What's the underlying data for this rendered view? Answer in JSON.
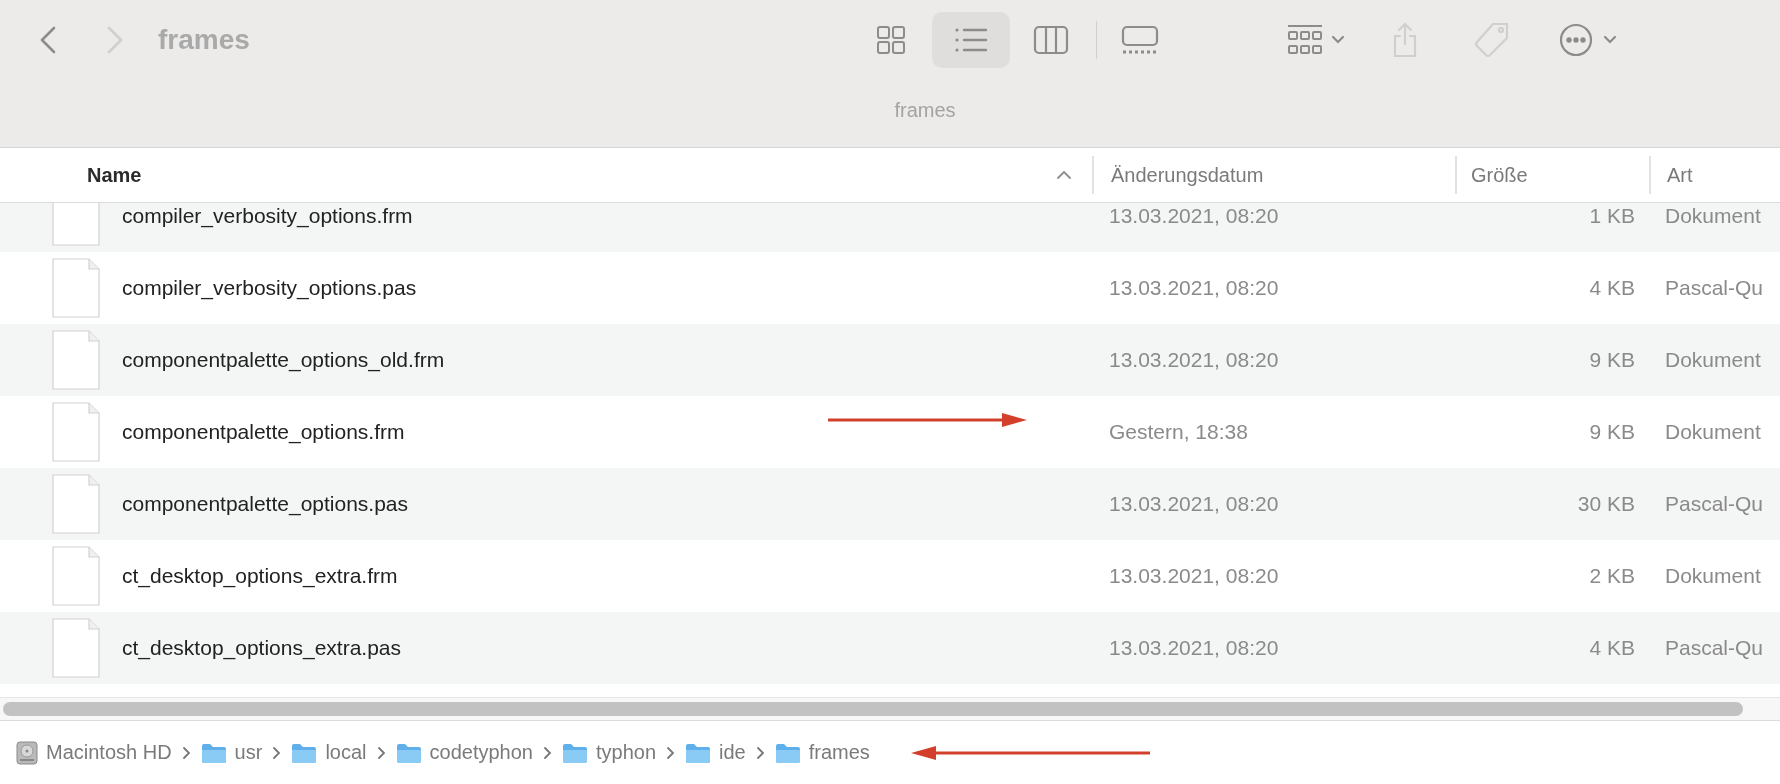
{
  "toolbar": {
    "title": "frames",
    "subtitle": "frames",
    "view_modes": [
      {
        "kind": "icons",
        "selected": false
      },
      {
        "kind": "list",
        "selected": true
      },
      {
        "kind": "columns",
        "selected": false
      },
      {
        "kind": "gallery",
        "selected": false
      }
    ]
  },
  "table": {
    "columns": [
      {
        "label": "Name",
        "sorted": true
      },
      {
        "label": "Änderungsdatum",
        "sorted": false
      },
      {
        "label": "Größe",
        "sorted": false
      },
      {
        "label": "Art",
        "sorted": false
      }
    ],
    "rows": [
      {
        "name": "compiler_verbosity_options.frm",
        "date": "13.03.2021, 08:20",
        "size": "1 KB",
        "kind": "Dokument"
      },
      {
        "name": "compiler_verbosity_options.pas",
        "date": "13.03.2021, 08:20",
        "size": "4 KB",
        "kind": "Pascal-Qu"
      },
      {
        "name": "componentpalette_options_old.frm",
        "date": "13.03.2021, 08:20",
        "size": "9 KB",
        "kind": "Dokument"
      },
      {
        "name": "componentpalette_options.frm",
        "date": "Gestern, 18:38",
        "size": "9 KB",
        "kind": "Dokument",
        "annotated": true
      },
      {
        "name": "componentpalette_options.pas",
        "date": "13.03.2021, 08:20",
        "size": "30 KB",
        "kind": "Pascal-Qu"
      },
      {
        "name": "ct_desktop_options_extra.frm",
        "date": "13.03.2021, 08:20",
        "size": "2 KB",
        "kind": "Dokument"
      },
      {
        "name": "ct_desktop_options_extra.pas",
        "date": "13.03.2021, 08:20",
        "size": "4 KB",
        "kind": "Pascal-Qu"
      }
    ]
  },
  "path_bar": {
    "annotated": true,
    "items": [
      {
        "label": "Macintosh HD",
        "kind": "disk"
      },
      {
        "label": "usr",
        "kind": "folder"
      },
      {
        "label": "local",
        "kind": "folder"
      },
      {
        "label": "codetyphon",
        "kind": "folder"
      },
      {
        "label": "typhon",
        "kind": "folder"
      },
      {
        "label": "ide",
        "kind": "folder"
      },
      {
        "label": "frames",
        "kind": "folder"
      }
    ]
  }
}
